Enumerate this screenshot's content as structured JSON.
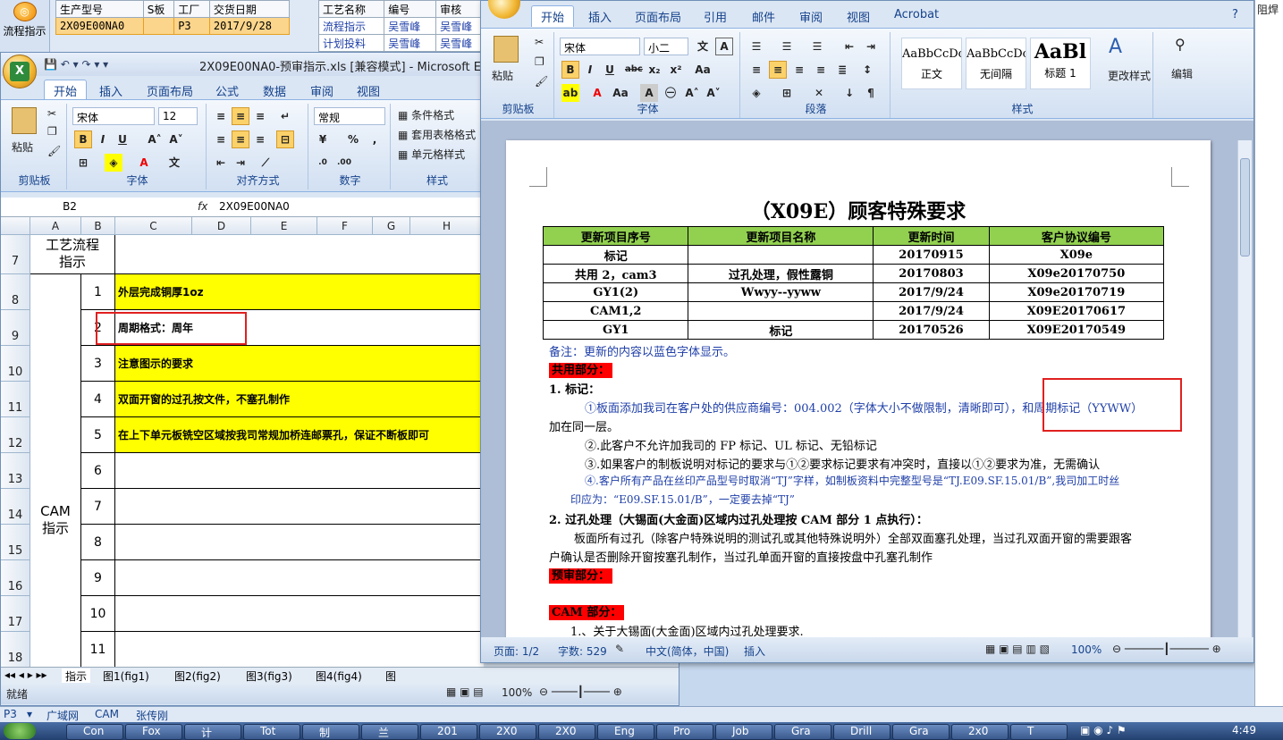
{
  "bg_app": {
    "icon_label": "流程指示",
    "grid1": {
      "headers": [
        "生产型号",
        "S板",
        "工厂",
        "交货日期"
      ],
      "row": [
        "2X09E00NA0",
        "",
        "P3",
        "2017/9/28"
      ]
    },
    "grid2": {
      "headers": [
        "工艺名称",
        "编号",
        "审核"
      ],
      "rows": [
        [
          "流程指示",
          "吴雪峰",
          "吴雪峰"
        ],
        [
          "计划投料",
          "吴雪峰",
          "吴雪峰"
        ]
      ]
    }
  },
  "excel": {
    "title": "2X09E00NA0-预审指示.xls  [兼容模式] - Microsoft Excel",
    "tabs": [
      "开始",
      "插入",
      "页面布局",
      "公式",
      "数据",
      "审阅",
      "视图"
    ],
    "font_name": "宋体",
    "font_size": "12",
    "number_format": "常规",
    "paste_label": "粘贴",
    "groups": [
      "剪贴板",
      "字体",
      "对齐方式",
      "数字",
      "样式"
    ],
    "style_items": [
      "条件格式",
      "套用表格格式",
      "单元格样式"
    ],
    "name_box": "B2",
    "fx": "fx",
    "formula": "2X09E00NA0",
    "columns": [
      "A",
      "B",
      "C",
      "D",
      "E",
      "F",
      "G",
      "H"
    ],
    "process_label": "工艺流程指示",
    "cam_label": "CAM指示",
    "rows": [
      {
        "rownum": "8",
        "num": "1",
        "text": "外层完成铜厚1oz",
        "highlight": true
      },
      {
        "rownum": "9",
        "num": "2",
        "text": "周期格式：周年",
        "highlight": false
      },
      {
        "rownum": "10",
        "num": "3",
        "text": "注意图示的要求",
        "highlight": true
      },
      {
        "rownum": "11",
        "num": "4",
        "text": "双面开窗的过孔按文件，不塞孔制作",
        "highlight": true
      },
      {
        "rownum": "12",
        "num": "5",
        "text": "在上下单元板铣空区域按我司常规加桥连邮票孔，保证不断板即可",
        "highlight": true
      },
      {
        "rownum": "13",
        "num": "6",
        "text": "",
        "highlight": false
      },
      {
        "rownum": "14",
        "num": "7",
        "text": "",
        "highlight": false
      },
      {
        "rownum": "15",
        "num": "8",
        "text": "",
        "highlight": false
      },
      {
        "rownum": "16",
        "num": "9",
        "text": "",
        "highlight": false
      },
      {
        "rownum": "17",
        "num": "10",
        "text": "",
        "highlight": false
      },
      {
        "rownum": "18",
        "num": "11",
        "text": "",
        "highlight": false
      }
    ],
    "row7": "7",
    "sheet_tabs": [
      "指示",
      "图1(fig1)",
      "图2(fig2)",
      "图3(fig3)",
      "图4(fig4)",
      "图"
    ],
    "status": "就绪",
    "zoom": "100%"
  },
  "word": {
    "tabs": [
      "开始",
      "插入",
      "页面布局",
      "引用",
      "邮件",
      "审阅",
      "视图",
      "Acrobat"
    ],
    "font_name": "宋体",
    "font_size": "小二",
    "paste_label": "粘贴",
    "groups": [
      "剪贴板",
      "字体",
      "段落",
      "样式"
    ],
    "styles": [
      {
        "preview": "AaBbCcDc",
        "name": "正文"
      },
      {
        "preview": "AaBbCcDc",
        "name": "无间隔"
      },
      {
        "preview": "AaBl",
        "name": "标题 1"
      }
    ],
    "change_styles": "更改样式",
    "edit": "编辑",
    "doc_title": "（X09E）顾客特殊要求",
    "table_headers": [
      "更新项目序号",
      "更新项目名称",
      "更新时间",
      "客户协议编号"
    ],
    "table_rows": [
      [
        "标记",
        "",
        "20170915",
        "X09e"
      ],
      [
        "共用 2，cam3",
        "过孔处理，假性露铜",
        "20170803",
        "X09e20170750"
      ],
      [
        "GY1(2)",
        "Wwyy--yyww",
        "2017/9/24",
        "X09e20170719"
      ],
      [
        "CAM1,2",
        "",
        "2017/9/24",
        "X09E20170617"
      ],
      [
        "GY1",
        "标记",
        "20170526",
        "X09E20170549"
      ]
    ],
    "note": "备注：更新的内容以蓝色字体显示。",
    "common": "共用部分：",
    "mark_title": "1. 标记：",
    "mark1a": "①板面添加我司在客户处的供应商编号：004.002（字体大小不做限制，清晰即可），和周期标记（YYWW）",
    "mark1b": "加在同一层。",
    "mark2": "②.此客户不允许加我司的 FP 标记、UL 标记、无铅标记",
    "mark3": "③.如果客户的制板说明对标记的要求与①②要求标记要求有冲突时，直接以①②要求为准，无需确认",
    "mark4a": "④.客户所有产品在丝印产品型号时取消“TJ”字样，如制板资料中完整型号是“TJ.E09.SF.15.01/B”,我司加工时丝",
    "mark4b": "印应为：“E09.SF.15.01/B”，一定要去掉“TJ”",
    "via_title": "2. 过孔处理（大锡面(大金面)区域内过孔处理按 CAM 部分 1 点执行）：",
    "via1": "板面所有过孔（除客户特殊说明的测试孔或其他特殊说明外）全部双面塞孔处理，当过孔双面开窗的需要跟客",
    "via2": "户确认是否删除开窗按塞孔制作，当过孔单面开窗的直接按盘中孔塞孔制作",
    "pre": "预审部分：",
    "cam": "CAM 部分：",
    "cam1": "1.、关于大锡面(大金面)区域内过孔处理要求.",
    "status_page": "页面: 1/2",
    "status_words": "字数: 529",
    "status_lang": "中文(简体，中国)",
    "status_insert": "插入",
    "zoom": "100%"
  },
  "right_strip": {
    "text": "阻焊"
  },
  "bottom_bar": {
    "items": [
      "P3",
      "广域网",
      "CAM",
      "张传刚"
    ]
  },
  "taskbar": {
    "items": [
      "Con",
      "Fox",
      "计",
      "Tot",
      "制",
      "兰",
      "201",
      "2X0",
      "2X0",
      "Eng",
      "Pro",
      "Job",
      "Gra",
      "Drill",
      "Gra",
      "2x0",
      "T"
    ],
    "clock": "4:49"
  },
  "colors": {
    "highlight": "#ffff00",
    "table_header": "#92d050",
    "alert_red": "#ff0000",
    "annotation_box": "#e02020"
  }
}
